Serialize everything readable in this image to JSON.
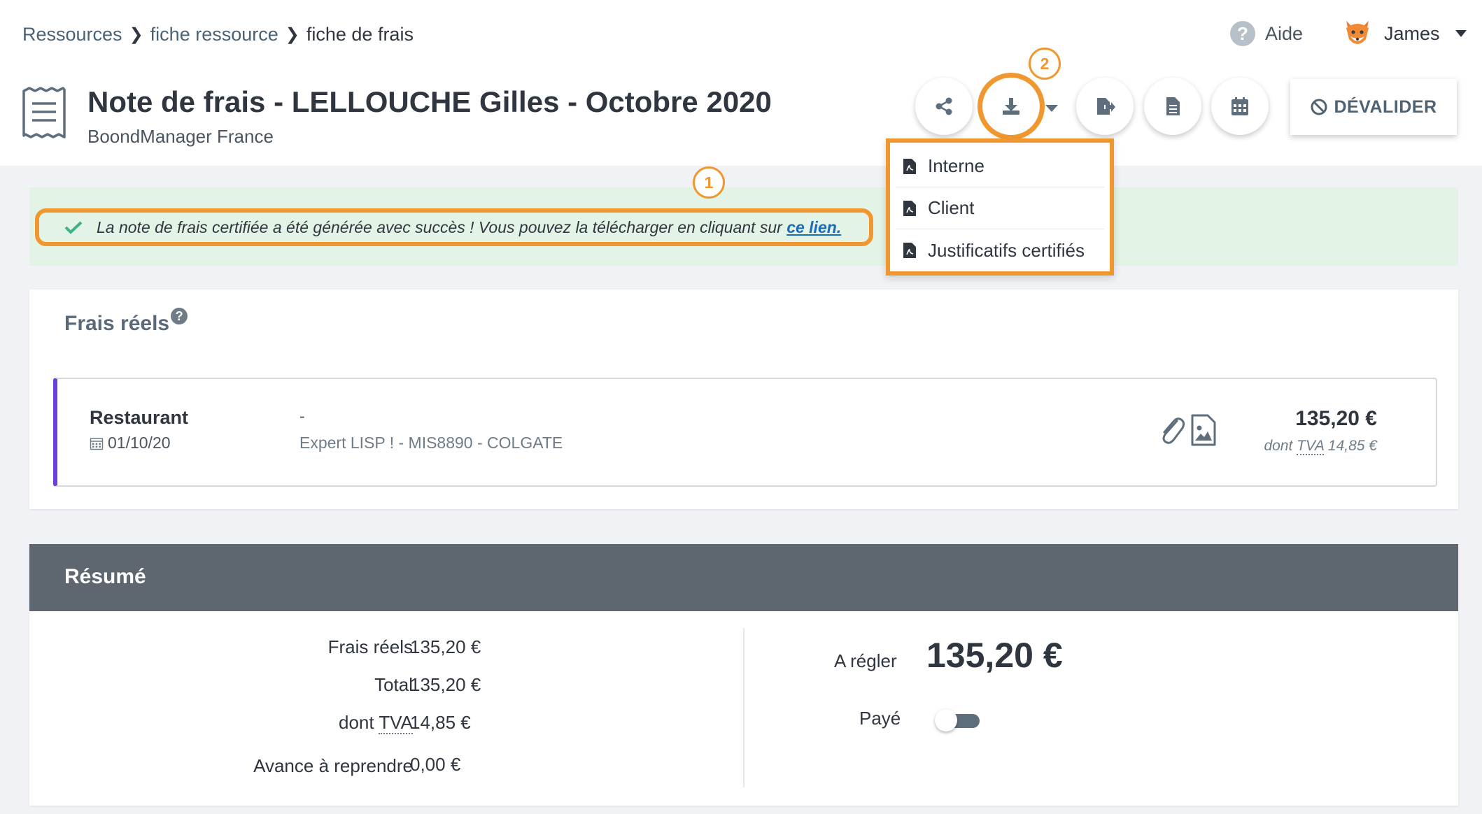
{
  "breadcrumb": {
    "items": [
      "Ressources",
      "fiche ressource"
    ],
    "current": "fiche de frais"
  },
  "topbar": {
    "help_label": "Aide",
    "user_name": "James"
  },
  "page": {
    "title": "Note de frais - LELLOUCHE Gilles - Octobre 2020",
    "subtitle": "BoondManager France"
  },
  "toolbar": {
    "buttons": [
      "share-icon",
      "download-icon",
      "export-icon",
      "document-icon",
      "calendar-icon"
    ],
    "devalider_label": "DÉVALIDER"
  },
  "annotations": {
    "badge_1": "1",
    "badge_2": "2"
  },
  "alert": {
    "message": "La note de frais certifiée a été générée avec succès ! Vous pouvez la télécharger en cliquant sur",
    "link": "ce lien."
  },
  "download_menu": {
    "items": [
      "Interne",
      "Client",
      "Justificatifs certifiés"
    ]
  },
  "frais_reels": {
    "title": "Frais réels",
    "row": {
      "category": "Restaurant",
      "date": "01/10/20",
      "dash": "-",
      "project": "Expert LISP ! - MIS8890 - COLGATE",
      "amount": "135,20 €",
      "tva_prefix": "dont",
      "tva_abbr": "TVA",
      "tva_value": "14,85 €"
    }
  },
  "resume": {
    "title": "Résumé",
    "frais_reels_label": "Frais réels",
    "frais_reels_value": "135,20 €",
    "total_label": "Total",
    "total_value": "135,20 €",
    "tva_prefix": "dont",
    "tva_abbr": "TVA",
    "tva_value": "14,85 €",
    "avance_label": "Avance à reprendre",
    "avance_value": "0,00 €",
    "regler_label": "A régler",
    "regler_value": "135,20 €",
    "paye_label": "Payé",
    "paye_on": false
  },
  "colors": {
    "highlight": "#f0982f",
    "link": "#1a6bb8",
    "accent_row": "#6b3fd8",
    "success_bg": "#e3f3e5",
    "success_icon": "#3fb27f"
  }
}
